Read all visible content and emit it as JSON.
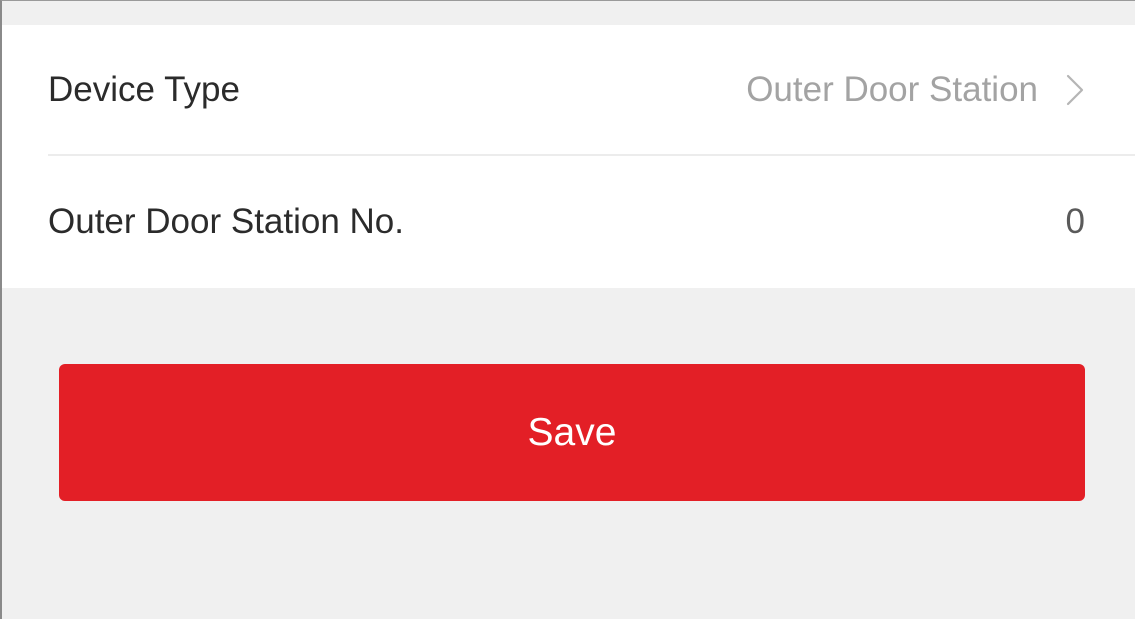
{
  "settings": {
    "device_type": {
      "label": "Device Type",
      "value": "Outer Door Station",
      "icon": "chevron-right-icon"
    },
    "station_no": {
      "label": "Outer Door Station No.",
      "value": "0"
    }
  },
  "actions": {
    "save_label": "Save"
  },
  "colors": {
    "accent": "#e31f26",
    "background": "#f0f0f0",
    "card": "#ffffff",
    "label_text": "#2b2b2b",
    "value_text": "#a3a3a3"
  }
}
